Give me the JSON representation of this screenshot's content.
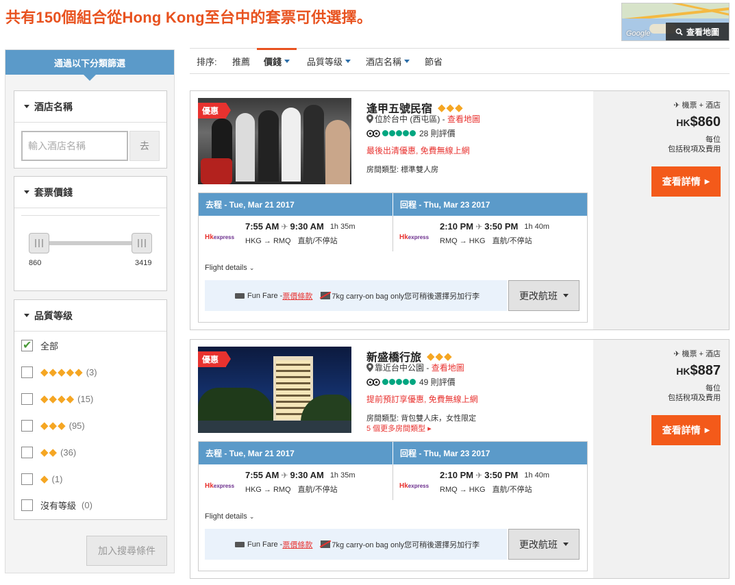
{
  "header": {
    "title": "共有150個組合從Hong Kong至台中的套票可供選擇。",
    "map_button": "查看地圖",
    "map_icon": "search-icon",
    "map_logo": "Google"
  },
  "sidebar": {
    "heading": "通過以下分類篩選",
    "hotel_name": {
      "title": "酒店名稱",
      "placeholder": "輸入酒店名稱",
      "go": "去"
    },
    "price": {
      "title": "套票價錢",
      "min": "860",
      "max": "3419"
    },
    "rating": {
      "title": "品質等级",
      "options": [
        {
          "label": "全部",
          "diamonds": "",
          "count": "",
          "checked": true
        },
        {
          "label": "",
          "diamonds": "◆◆◆◆◆",
          "count": "(3)",
          "checked": false
        },
        {
          "label": "",
          "diamonds": "◆◆◆◆",
          "count": "(15)",
          "checked": false
        },
        {
          "label": "",
          "diamonds": "◆◆◆",
          "count": "(95)",
          "checked": false
        },
        {
          "label": "",
          "diamonds": "◆◆",
          "count": "(36)",
          "checked": false
        },
        {
          "label": "",
          "diamonds": "◆",
          "count": "(1)",
          "checked": false
        },
        {
          "label": "沒有等級",
          "diamonds": "",
          "count": "(0)",
          "checked": false
        }
      ]
    },
    "add_button": "加入搜尋條件"
  },
  "sort": {
    "label": "排序:",
    "items": [
      "推薦",
      "價錢",
      "品質等级",
      "酒店名稱",
      "節省"
    ],
    "active": "價錢"
  },
  "cards": [
    {
      "badge": "優惠",
      "name": "逢甲五號民宿",
      "diamonds": "◆◆◆",
      "location": "位於台中 (西屯區)",
      "map_link": "查看地圖",
      "reviews": "28 則評價",
      "promo": "最後出清優惠, 免費無線上網",
      "room": "房間類型: 標準雙人房",
      "more_rooms": "",
      "package": "機票 + 酒店",
      "currency": "HK",
      "price": "$860",
      "per": "每位",
      "tax": "包括稅項及費用",
      "detail_button": "查看詳情",
      "outbound": {
        "header": "去程 - Tue, Mar 21 2017",
        "dep": "7:55 AM",
        "arr": "9:30 AM",
        "duration": "1h 35m",
        "route": "HKG → RMQ",
        "stops": "直航/不停站"
      },
      "return": {
        "header": "回程 - Thu, Mar 23 2017",
        "dep": "2:10 PM",
        "arr": "3:50 PM",
        "duration": "1h 40m",
        "route": "RMQ → HKG",
        "stops": "直航/不停站"
      },
      "airline": {
        "a": "Hk",
        "b": "express"
      },
      "flight_details": "Flight details",
      "fare_name": "Fun Fare - ",
      "fare_rules": "票價條款",
      "baggage": "7kg carry-on bag only您可稍後選擇另加行李",
      "change_button": "更改航班"
    },
    {
      "badge": "優惠",
      "name": "新盛橋行旅",
      "diamonds": "◆◆◆",
      "location": "靠近台中公園",
      "map_link": "查看地圖",
      "reviews": "49 則評價",
      "promo": "提前預訂享優惠, 免費無線上網",
      "room": "房間類型: 背包雙人床，女性限定",
      "more_rooms": "5 個更多房間類型 ▸",
      "package": "機票 + 酒店",
      "currency": "HK",
      "price": "$887",
      "per": "每位",
      "tax": "包括稅項及費用",
      "detail_button": "查看詳情",
      "outbound": {
        "header": "去程 - Tue, Mar 21 2017",
        "dep": "7:55 AM",
        "arr": "9:30 AM",
        "duration": "1h 35m",
        "route": "HKG → RMQ",
        "stops": "直航/不停站"
      },
      "return": {
        "header": "回程 - Thu, Mar 23 2017",
        "dep": "2:10 PM",
        "arr": "3:50 PM",
        "duration": "1h 40m",
        "route": "RMQ → HKG",
        "stops": "直航/不停站"
      },
      "airline": {
        "a": "Hk",
        "b": "express"
      },
      "flight_details": "Flight details",
      "fare_name": "Fun Fare - ",
      "fare_rules": "票價條款",
      "baggage": "7kg carry-on bag only您可稍後選擇另加行李",
      "change_button": "更改航班"
    }
  ],
  "colors": {
    "accent": "#e8521f",
    "filter_blue": "#5b9ac9",
    "cta": "#f35a1a",
    "promo_red": "#e8322f",
    "diamond": "#f5a623"
  }
}
